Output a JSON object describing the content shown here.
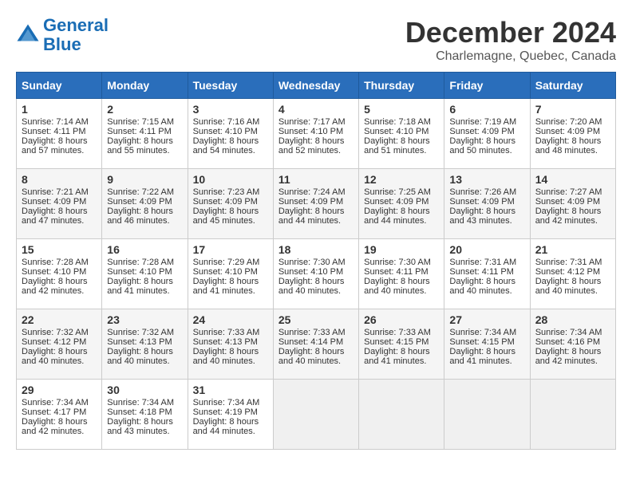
{
  "header": {
    "logo_line1": "General",
    "logo_line2": "Blue",
    "month": "December 2024",
    "location": "Charlemagne, Quebec, Canada"
  },
  "weekdays": [
    "Sunday",
    "Monday",
    "Tuesday",
    "Wednesday",
    "Thursday",
    "Friday",
    "Saturday"
  ],
  "weeks": [
    [
      {
        "day": "1",
        "sunrise": "Sunrise: 7:14 AM",
        "sunset": "Sunset: 4:11 PM",
        "daylight": "Daylight: 8 hours and 57 minutes."
      },
      {
        "day": "2",
        "sunrise": "Sunrise: 7:15 AM",
        "sunset": "Sunset: 4:11 PM",
        "daylight": "Daylight: 8 hours and 55 minutes."
      },
      {
        "day": "3",
        "sunrise": "Sunrise: 7:16 AM",
        "sunset": "Sunset: 4:10 PM",
        "daylight": "Daylight: 8 hours and 54 minutes."
      },
      {
        "day": "4",
        "sunrise": "Sunrise: 7:17 AM",
        "sunset": "Sunset: 4:10 PM",
        "daylight": "Daylight: 8 hours and 52 minutes."
      },
      {
        "day": "5",
        "sunrise": "Sunrise: 7:18 AM",
        "sunset": "Sunset: 4:10 PM",
        "daylight": "Daylight: 8 hours and 51 minutes."
      },
      {
        "day": "6",
        "sunrise": "Sunrise: 7:19 AM",
        "sunset": "Sunset: 4:09 PM",
        "daylight": "Daylight: 8 hours and 50 minutes."
      },
      {
        "day": "7",
        "sunrise": "Sunrise: 7:20 AM",
        "sunset": "Sunset: 4:09 PM",
        "daylight": "Daylight: 8 hours and 48 minutes."
      }
    ],
    [
      {
        "day": "8",
        "sunrise": "Sunrise: 7:21 AM",
        "sunset": "Sunset: 4:09 PM",
        "daylight": "Daylight: 8 hours and 47 minutes."
      },
      {
        "day": "9",
        "sunrise": "Sunrise: 7:22 AM",
        "sunset": "Sunset: 4:09 PM",
        "daylight": "Daylight: 8 hours and 46 minutes."
      },
      {
        "day": "10",
        "sunrise": "Sunrise: 7:23 AM",
        "sunset": "Sunset: 4:09 PM",
        "daylight": "Daylight: 8 hours and 45 minutes."
      },
      {
        "day": "11",
        "sunrise": "Sunrise: 7:24 AM",
        "sunset": "Sunset: 4:09 PM",
        "daylight": "Daylight: 8 hours and 44 minutes."
      },
      {
        "day": "12",
        "sunrise": "Sunrise: 7:25 AM",
        "sunset": "Sunset: 4:09 PM",
        "daylight": "Daylight: 8 hours and 44 minutes."
      },
      {
        "day": "13",
        "sunrise": "Sunrise: 7:26 AM",
        "sunset": "Sunset: 4:09 PM",
        "daylight": "Daylight: 8 hours and 43 minutes."
      },
      {
        "day": "14",
        "sunrise": "Sunrise: 7:27 AM",
        "sunset": "Sunset: 4:09 PM",
        "daylight": "Daylight: 8 hours and 42 minutes."
      }
    ],
    [
      {
        "day": "15",
        "sunrise": "Sunrise: 7:28 AM",
        "sunset": "Sunset: 4:10 PM",
        "daylight": "Daylight: 8 hours and 42 minutes."
      },
      {
        "day": "16",
        "sunrise": "Sunrise: 7:28 AM",
        "sunset": "Sunset: 4:10 PM",
        "daylight": "Daylight: 8 hours and 41 minutes."
      },
      {
        "day": "17",
        "sunrise": "Sunrise: 7:29 AM",
        "sunset": "Sunset: 4:10 PM",
        "daylight": "Daylight: 8 hours and 41 minutes."
      },
      {
        "day": "18",
        "sunrise": "Sunrise: 7:30 AM",
        "sunset": "Sunset: 4:10 PM",
        "daylight": "Daylight: 8 hours and 40 minutes."
      },
      {
        "day": "19",
        "sunrise": "Sunrise: 7:30 AM",
        "sunset": "Sunset: 4:11 PM",
        "daylight": "Daylight: 8 hours and 40 minutes."
      },
      {
        "day": "20",
        "sunrise": "Sunrise: 7:31 AM",
        "sunset": "Sunset: 4:11 PM",
        "daylight": "Daylight: 8 hours and 40 minutes."
      },
      {
        "day": "21",
        "sunrise": "Sunrise: 7:31 AM",
        "sunset": "Sunset: 4:12 PM",
        "daylight": "Daylight: 8 hours and 40 minutes."
      }
    ],
    [
      {
        "day": "22",
        "sunrise": "Sunrise: 7:32 AM",
        "sunset": "Sunset: 4:12 PM",
        "daylight": "Daylight: 8 hours and 40 minutes."
      },
      {
        "day": "23",
        "sunrise": "Sunrise: 7:32 AM",
        "sunset": "Sunset: 4:13 PM",
        "daylight": "Daylight: 8 hours and 40 minutes."
      },
      {
        "day": "24",
        "sunrise": "Sunrise: 7:33 AM",
        "sunset": "Sunset: 4:13 PM",
        "daylight": "Daylight: 8 hours and 40 minutes."
      },
      {
        "day": "25",
        "sunrise": "Sunrise: 7:33 AM",
        "sunset": "Sunset: 4:14 PM",
        "daylight": "Daylight: 8 hours and 40 minutes."
      },
      {
        "day": "26",
        "sunrise": "Sunrise: 7:33 AM",
        "sunset": "Sunset: 4:15 PM",
        "daylight": "Daylight: 8 hours and 41 minutes."
      },
      {
        "day": "27",
        "sunrise": "Sunrise: 7:34 AM",
        "sunset": "Sunset: 4:15 PM",
        "daylight": "Daylight: 8 hours and 41 minutes."
      },
      {
        "day": "28",
        "sunrise": "Sunrise: 7:34 AM",
        "sunset": "Sunset: 4:16 PM",
        "daylight": "Daylight: 8 hours and 42 minutes."
      }
    ],
    [
      {
        "day": "29",
        "sunrise": "Sunrise: 7:34 AM",
        "sunset": "Sunset: 4:17 PM",
        "daylight": "Daylight: 8 hours and 42 minutes."
      },
      {
        "day": "30",
        "sunrise": "Sunrise: 7:34 AM",
        "sunset": "Sunset: 4:18 PM",
        "daylight": "Daylight: 8 hours and 43 minutes."
      },
      {
        "day": "31",
        "sunrise": "Sunrise: 7:34 AM",
        "sunset": "Sunset: 4:19 PM",
        "daylight": "Daylight: 8 hours and 44 minutes."
      },
      null,
      null,
      null,
      null
    ]
  ]
}
